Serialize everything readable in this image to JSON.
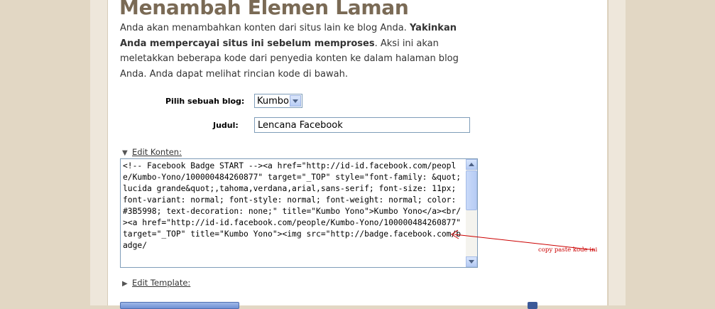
{
  "page": {
    "title": "Menambah Elemen Laman",
    "description": {
      "part1": "Anda akan menambahkan konten dari situs lain ke blog Anda. ",
      "bold": "Yakinkan Anda mempercayai situs ini sebelum memproses",
      "part2": ". Aksi ini akan meletakkan beberapa kode dari penyedia konten ke dalam halaman blog Anda. Anda dapat melihat rincian kode di bawah."
    }
  },
  "form": {
    "blog_label": "Pilih sebuah blog:",
    "blog_selected": "Kumbo",
    "title_label": "Judul:",
    "title_value": "Lencana Facebook"
  },
  "sections": {
    "edit_content": "Edit Konten:",
    "edit_template": "Edit Template:"
  },
  "code_content": "<!-- Facebook Badge START --><a href=\"http://id-id.facebook.com/people/Kumbo-Yono/100000484260877\" target=\"_TOP\" style=\"font-family: &quot;lucida grande&quot;,tahoma,verdana,arial,sans-serif; font-size: 11px; font-variant: normal; font-style: normal; font-weight: normal; color: #3B5998; text-decoration: none;\" title=\"Kumbo Yono\">Kumbo Yono</a><br/><a href=\"http://id-id.facebook.com/people/Kumbo-Yono/100000484260877\" target=\"_TOP\" title=\"Kumbo Yono\"><img src=\"http://badge.facebook.com/badge/",
  "annotation": {
    "text": "copy paste kode ini",
    "color": "#cc0000"
  },
  "icons": {
    "collapse_open": "triangle-down-icon",
    "collapse_closed": "triangle-right-icon",
    "dropdown": "chevron-down-icon",
    "facebook": "facebook-icon"
  }
}
